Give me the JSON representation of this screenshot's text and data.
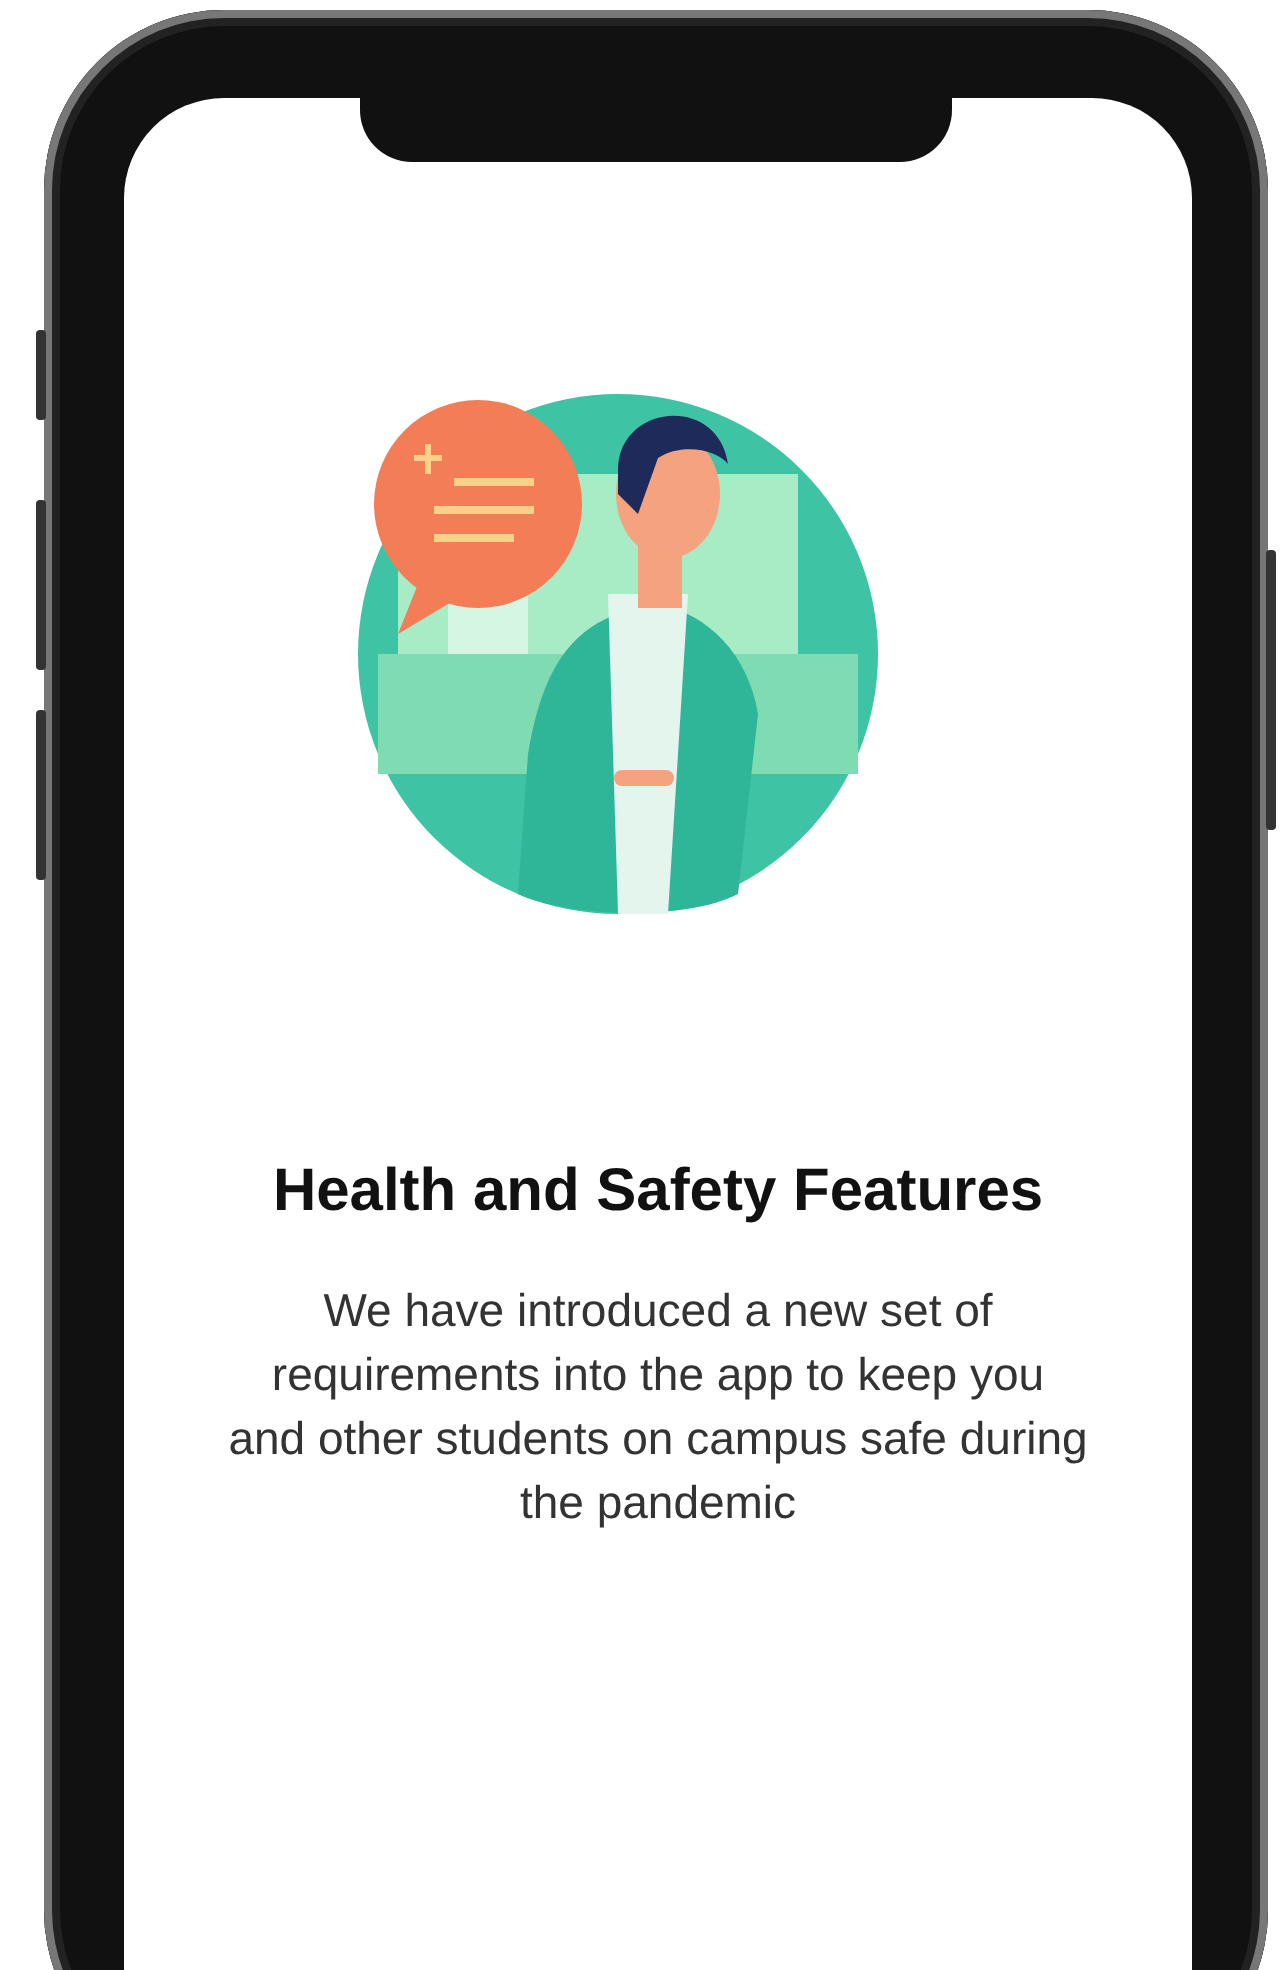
{
  "screen": {
    "title": "Health and Safety Features",
    "description": "We have introduced a new set of requirements into the app to keep you and other students on campus safe during the pandemic"
  }
}
